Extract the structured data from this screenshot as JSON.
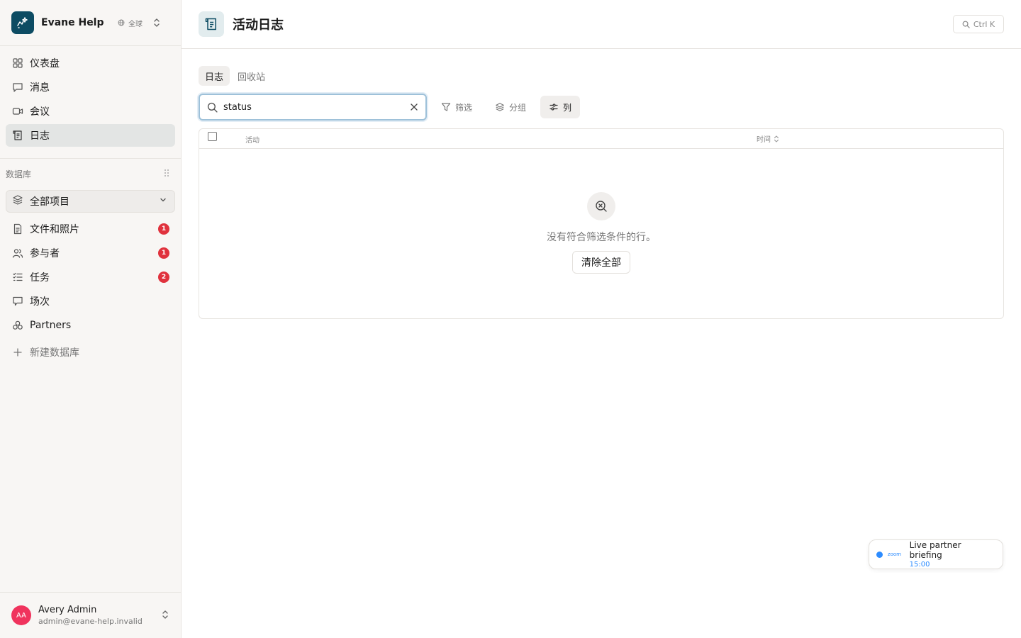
{
  "workspace": {
    "name": "Evane Help ...",
    "scope": "全球"
  },
  "nav": [
    {
      "label": "仪表盘",
      "icon": "grid-icon"
    },
    {
      "label": "消息",
      "icon": "message-icon"
    },
    {
      "label": "会议",
      "icon": "video-icon"
    },
    {
      "label": "日志",
      "icon": "log-icon",
      "active": true
    }
  ],
  "databases": {
    "heading": "数据库",
    "selector": "全部项目",
    "items": [
      {
        "label": "文件和照片",
        "badge": "1",
        "icon": "file-icon"
      },
      {
        "label": "参与者",
        "badge": "1",
        "icon": "users-icon"
      },
      {
        "label": "任务",
        "badge": "2",
        "icon": "tasks-icon"
      },
      {
        "label": "场次",
        "badge": "",
        "icon": "presentation-icon"
      },
      {
        "label": "Partners",
        "badge": "",
        "icon": "partners-icon"
      }
    ],
    "new_label": "新建数据库"
  },
  "user": {
    "initials": "AA",
    "name": "Avery Admin",
    "email": "admin@evane-help.invalid"
  },
  "page": {
    "title": "活动日志",
    "shortcut": "Ctrl K"
  },
  "tabs": [
    {
      "label": "日志",
      "active": true
    },
    {
      "label": "回收站",
      "active": false
    }
  ],
  "toolbar": {
    "search_value": "status",
    "filter_label": "筛选",
    "group_label": "分组",
    "columns_label": "列"
  },
  "table": {
    "columns": [
      "活动",
      "时间"
    ],
    "empty_message": "没有符合筛选条件的行。",
    "clear_all_label": "清除全部"
  },
  "toast": {
    "app": "zoom",
    "title": "Live partner briefing",
    "time": "15:00"
  },
  "colors": {
    "brand": "#0d4c63",
    "badge": "#e0323d",
    "avatar": "#f0335d",
    "zoom_blue": "#2d8cff"
  }
}
